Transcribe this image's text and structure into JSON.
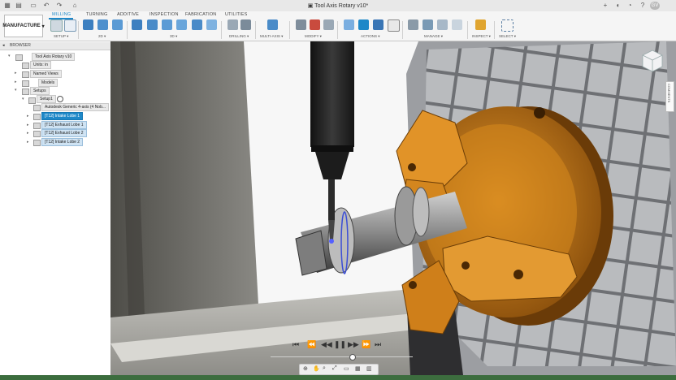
{
  "window": {
    "title": "Tool Axis Rotary v10*",
    "user_initials": "GV"
  },
  "ribbon": {
    "workspace": "MANUFACTURE",
    "tabs": [
      "MILLING",
      "TURNING",
      "ADDITIVE",
      "INSPECTION",
      "FABRICATION",
      "UTILITIES"
    ],
    "active_tab": "MILLING",
    "groups": [
      "SETUP",
      "2D",
      "3D",
      "DRILLING",
      "MULTI-AXIS",
      "MODIFY",
      "ACTIONS",
      "MANAGE",
      "INSPECT",
      "SELECT"
    ]
  },
  "browser": {
    "title": "BROWSER",
    "root": "Tool Axis Rotary v10",
    "units": "Units: in",
    "named_views": "Named Views",
    "models": "Models",
    "setups": "Setups",
    "setup1": "Setup1",
    "tool": "Autodesk Generic 4-axis (4 Nob...",
    "operations": [
      "[T12] Intake Lobe 1",
      "[T12] Exhaust Lobe 1",
      "[T12] Exhaust Lobe 2",
      "[T12] Intake Lobe 2"
    ],
    "selected_operation": "[T12] Intake Lobe 1"
  },
  "viewport": {
    "side_panel_label": "COMMENTS"
  },
  "playback": {
    "progress": 0.57
  },
  "colors": {
    "accent": "#1e88c8",
    "chuck_orange": "#d98a1f",
    "status_green": "#3c6d3e"
  }
}
